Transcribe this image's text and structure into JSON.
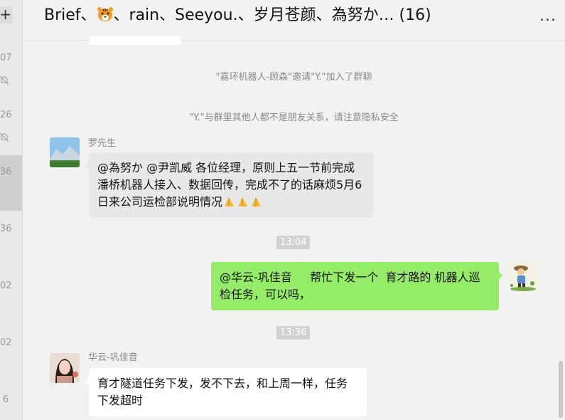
{
  "left_list": {
    "numbers": [
      "07",
      "26",
      "36",
      "36",
      "02",
      "02",
      "6"
    ]
  },
  "header": {
    "title_part1": "Brief、",
    "title_part2": "、rain、Seeyou.、岁月苍颜、為努か… (16)",
    "more_label": "..."
  },
  "messages": {
    "system1": "\"嘉环机器人-顾森\"邀请\"Y.\"加入了群聊",
    "system2": "\"Y.\"与群里其他人都不是朋友关系，请注意隐私安全",
    "msg1": {
      "sender": "罗先生",
      "text": "@為努か @尹凯威 各位经理，原则上五一节前完成潘桥机器人接入、数据回传，完成不了的话麻烦5月6日来公司运检部说明情况"
    },
    "time1": "13:04",
    "msg2": {
      "text": "@华云-巩佳音     帮忙下发一个  育才路的 机器人巡检任务，可以吗，"
    },
    "time2": "13:36",
    "msg3": {
      "sender": "华云-巩佳音",
      "text": "育才隧道任务下发，发不下去，和上周一样，任务下发超时"
    }
  },
  "icons": {
    "tiger": "tiger-face-emoji",
    "mute": "bell-muted-icon",
    "hands": "folded-hands-emoji"
  },
  "colors": {
    "green_bubble": "#95ec69",
    "white_bubble": "#ffffff",
    "background": "#f2f2f2"
  }
}
